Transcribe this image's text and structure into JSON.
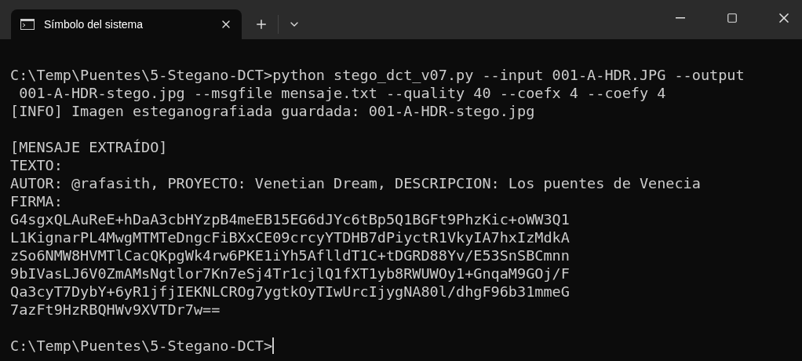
{
  "window": {
    "tab": {
      "title": "Símbolo del sistema",
      "selected": true
    }
  },
  "terminal": {
    "blocks": [
      [
        "C:\\Temp\\Puentes\\5-Stegano-DCT>python stego_dct_v07.py --input 001-A-HDR.JPG --output",
        " 001-A-HDR-stego.jpg --msgfile mensaje.txt --quality 40 --coefx 4 --coefy 4",
        "[INFO] Imagen esteganografiada guardada: 001-A-HDR-stego.jpg"
      ],
      [
        "[MENSAJE EXTRAÍDO]",
        "TEXTO:",
        "AUTOR: @rafasith, PROYECTO: Venetian Dream, DESCRIPCION: Los puentes de Venecia",
        "FIRMA:",
        "G4sgxQLAuReE+hDaA3cbHYzpB4meEB15EG6dJYc6tBp5Q1BGFt9PhzKic+oWW3Q1",
        "L1KignarPL4MwgMTMTeDngcFiBXxCE09crcyYTDHB7dPiyctR1VkyIA7hxIzMdkA",
        "zSo6NMW8HVMTlCacQKpgWk4rw6PKE1iYh5AflldT1C+tDGRD88Yv/E53SnSBCmnn",
        "9bIVasLJ6V0ZmAMsNgtlor7Kn7eSj4Tr1cjlQ1fXT1yb8RWUWOy1+GnqaM9GOj/F",
        "Qa3cyT7DybY+6yR1jfjIEKNLCROg7ygtkOyTIwUrcIjygNA80l/dhgF96b31mmeG",
        "7azFt9HzRBQHWv9XVTDr7w=="
      ],
      [
        "C:\\Temp\\Puentes\\5-Stegano-DCT>"
      ]
    ],
    "cursor": true
  }
}
